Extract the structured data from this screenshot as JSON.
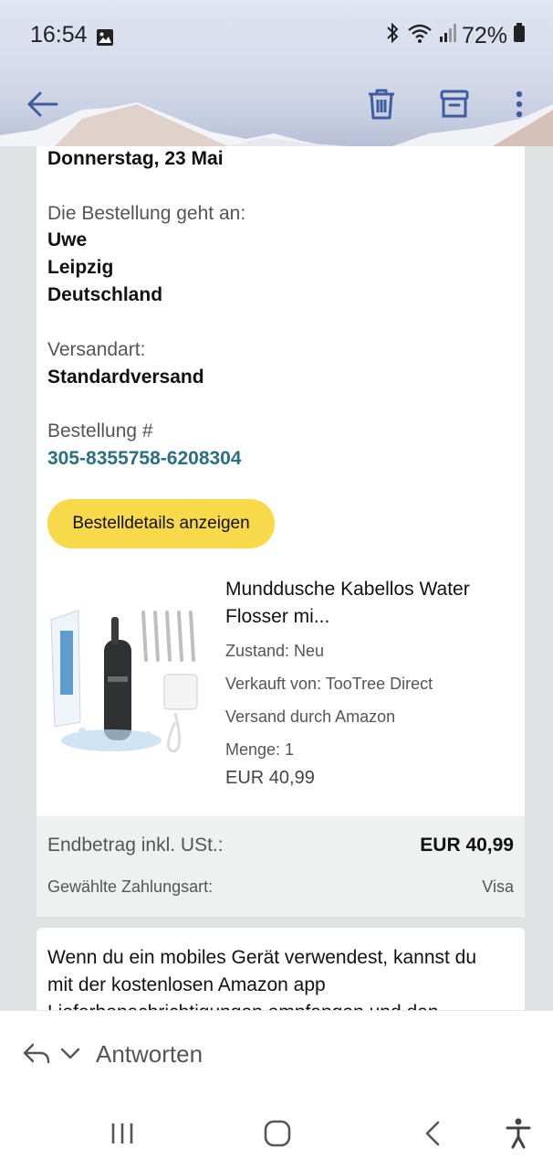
{
  "status_bar": {
    "time": "16:54",
    "battery": "72%",
    "icons": [
      "gallery-icon",
      "bluetooth-icon",
      "wifi-icon",
      "signal-icon",
      "battery-icon"
    ]
  },
  "toolbar": {
    "icons": [
      "back-arrow-icon",
      "trash-icon",
      "archive-icon",
      "more-vert-icon"
    ],
    "accent_color": "#3d5d9e"
  },
  "mail": {
    "delivery_date": "Donnerstag, 23 Mai",
    "ship_to_label": "Die Bestellung geht an:",
    "ship_to_name": "Uwe",
    "ship_to_city": "Leipzig",
    "ship_to_country": "Deutschland",
    "shipping_method_label": "Versandart:",
    "shipping_method": "Standardversand",
    "order_label": "Bestellung #",
    "order_number": "305-8355758-6208304",
    "details_button": "Bestelldetails anzeigen",
    "product": {
      "title_line1": "Munddusche Kabellos Water",
      "title_line2": "Flosser mi...",
      "condition": "Zustand: Neu",
      "seller": "Verkauft von: TooTree Direct",
      "fulfillment": "Versand durch Amazon",
      "quantity": "Menge: 1",
      "price": "EUR 40,99"
    },
    "summary": {
      "total_label": "Endbetrag inkl. USt.:",
      "total_value": "EUR 40,99",
      "payment_label": "Gewählte Zahlungsart:",
      "payment_value": "Visa"
    },
    "app_promo": {
      "line1": "Wenn du ein mobiles Gerät verwendest, kannst du",
      "line2": "mit der kostenlosen Amazon app",
      "line3": "Lieferbenachrichtigungen empfangen und den"
    }
  },
  "reply_bar": {
    "label": "Antworten",
    "icons": [
      "reply-icon",
      "chevron-down-icon"
    ]
  },
  "nav_bar": {
    "icons": [
      "recents-icon",
      "home-icon",
      "back-icon",
      "accessibility-icon"
    ]
  },
  "colors": {
    "button_yellow": "#f8d94a",
    "link_teal": "#2b7080",
    "page_bg": "#dfe3e4"
  }
}
